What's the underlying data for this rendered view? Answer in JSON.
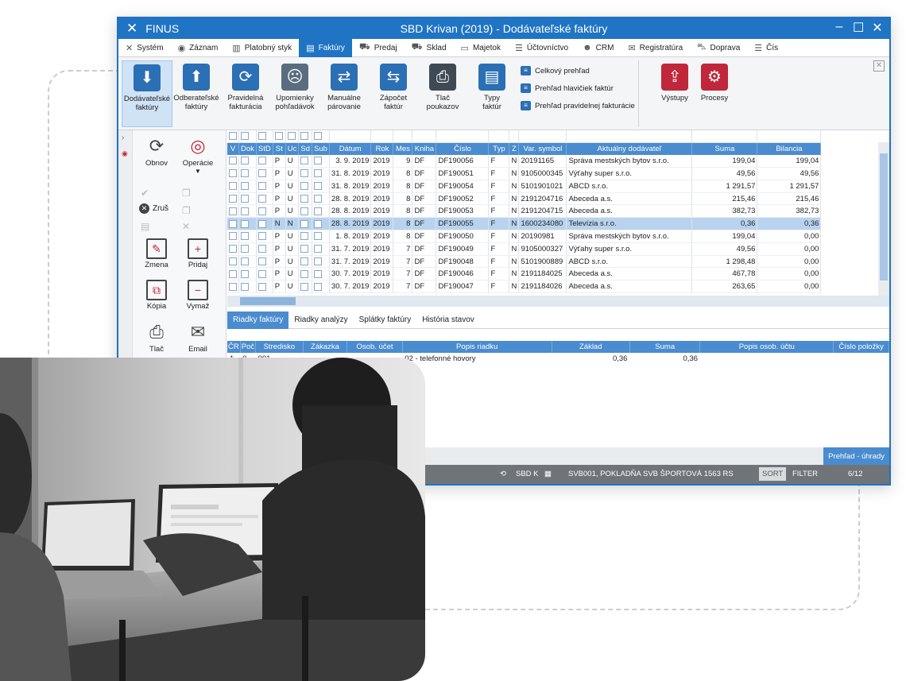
{
  "window": {
    "brand": "FINUS",
    "title": "SBD Krivan (2019) - Dodávateľské faktúry"
  },
  "menu": [
    {
      "label": "Systém",
      "icon": "x-icon"
    },
    {
      "label": "Záznam",
      "icon": "record-icon"
    },
    {
      "label": "Platobný styk",
      "icon": "bank-icon"
    },
    {
      "label": "Faktúry",
      "icon": "invoice-icon",
      "active": true
    },
    {
      "label": "Predaj",
      "icon": "cart-icon"
    },
    {
      "label": "Sklad",
      "icon": "truck-icon"
    },
    {
      "label": "Majetok",
      "icon": "monitor-icon"
    },
    {
      "label": "Účtovníctvo",
      "icon": "ledger-icon"
    },
    {
      "label": "CRM",
      "icon": "people-icon"
    },
    {
      "label": "Registratúra",
      "icon": "mail-icon"
    },
    {
      "label": "Doprava",
      "icon": "car-icon"
    },
    {
      "label": "Čís",
      "icon": "list-icon"
    }
  ],
  "ribbon": {
    "buttons": [
      {
        "l1": "Dodávateľské",
        "l2": "faktúry",
        "color": "#2b6fb5",
        "icon": "inbox-down-icon"
      },
      {
        "l1": "Odberateľské",
        "l2": "faktúry",
        "color": "#2b6fb5",
        "icon": "inbox-up-icon"
      },
      {
        "l1": "Pravidelná",
        "l2": "fakturácia",
        "color": "#2b6fb5",
        "icon": "recurring-invoice-icon"
      },
      {
        "l1": "Upomienky",
        "l2": "pohľadávok",
        "color": "#5a6c80",
        "icon": "reminder-icon"
      },
      {
        "l1": "Manuálne",
        "l2": "párovanie",
        "color": "#2b6fb5",
        "icon": "pairing-icon"
      },
      {
        "l1": "Zápočet",
        "l2": "faktúr",
        "color": "#2b6fb5",
        "icon": "offset-icon"
      },
      {
        "l1": "Tlač",
        "l2": "poukazov",
        "color": "#3f4a55",
        "icon": "printer-icon"
      },
      {
        "l1": "Typy",
        "l2": "faktúr",
        "color": "#2b6fb5",
        "icon": "invoice-types-icon"
      }
    ],
    "list": [
      "Celkový prehľad",
      "Prehľad hlavičiek faktúr",
      "Prehľad pravidelnej fakturácie"
    ],
    "outputs": {
      "label": "Výstupy",
      "color": "#c0273a"
    },
    "processes": {
      "label": "Procesy",
      "color": "#c0273a"
    }
  },
  "side": {
    "refresh": "Obnov",
    "operations": "Operácie",
    "cancel": "Zruš",
    "edit": "Zmena",
    "add": "Pridaj",
    "copy": "Kópia",
    "remove": "Vymaž",
    "print": "Tlač",
    "email": "Email"
  },
  "table": {
    "columns": [
      "V",
      "Dok",
      "StD",
      "St",
      "Uc",
      "Sd",
      "Sub",
      "Dátum",
      "Rok",
      "Mes",
      "Kniha",
      "Číslo",
      "Typ",
      "Z",
      "Var. symbol",
      "Aktuálny dodávateľ",
      "Suma",
      "Bilancia"
    ],
    "rows": [
      {
        "st": "P",
        "uc": "U",
        "date": "3. 9. 2019",
        "year": "2019",
        "month": "9",
        "book": "DF",
        "num": "DF190056",
        "type": "F",
        "z": "N",
        "vs": "20191165",
        "supplier": "Správa mestských bytov s.r.o.",
        "sum": "199,04",
        "bal": "199,04"
      },
      {
        "st": "P",
        "uc": "U",
        "date": "31. 8. 2019",
        "year": "2019",
        "month": "8",
        "book": "DF",
        "num": "DF190051",
        "type": "F",
        "z": "N",
        "vs": "9105000345",
        "supplier": "Výťahy super s.r.o.",
        "sum": "49,56",
        "bal": "49,56"
      },
      {
        "st": "P",
        "uc": "U",
        "date": "31. 8. 2019",
        "year": "2019",
        "month": "8",
        "book": "DF",
        "num": "DF190054",
        "type": "F",
        "z": "N",
        "vs": "5101901021",
        "supplier": "ABCD s.r.o.",
        "sum": "1 291,57",
        "bal": "1 291,57"
      },
      {
        "st": "P",
        "uc": "U",
        "date": "28. 8. 2019",
        "year": "2019",
        "month": "8",
        "book": "DF",
        "num": "DF190052",
        "type": "F",
        "z": "N",
        "vs": "2191204716",
        "supplier": "Abeceda a.s.",
        "sum": "215,46",
        "bal": "215,46"
      },
      {
        "st": "P",
        "uc": "U",
        "date": "28. 8. 2019",
        "year": "2019",
        "month": "8",
        "book": "DF",
        "num": "DF190053",
        "type": "F",
        "z": "N",
        "vs": "2191204715",
        "supplier": "Abeceda a.s.",
        "sum": "382,73",
        "bal": "382,73"
      },
      {
        "st": "N",
        "uc": "N",
        "date": "28. 8. 2019",
        "year": "2019",
        "month": "8",
        "book": "DF",
        "num": "DF190055",
        "type": "F",
        "z": "N",
        "vs": "1600234080",
        "supplier": "Televízia s.r.o.",
        "sum": "0,36",
        "bal": "0,36",
        "selected": true
      },
      {
        "st": "P",
        "uc": "U",
        "date": "1. 8. 2019",
        "year": "2019",
        "month": "8",
        "book": "DF",
        "num": "DF190050",
        "type": "F",
        "z": "N",
        "vs": "20190981",
        "supplier": "Správa mestských bytov s.r.o.",
        "sum": "199,04",
        "bal": "0,00"
      },
      {
        "st": "P",
        "uc": "U",
        "date": "31. 7. 2019",
        "year": "2019",
        "month": "7",
        "book": "DF",
        "num": "DF190049",
        "type": "F",
        "z": "N",
        "vs": "9105000327",
        "supplier": "Výťahy super s.r.o.",
        "sum": "49,56",
        "bal": "0,00"
      },
      {
        "st": "P",
        "uc": "U",
        "date": "31. 7. 2019",
        "year": "2019",
        "month": "7",
        "book": "DF",
        "num": "DF190048",
        "type": "F",
        "z": "N",
        "vs": "5101900889",
        "supplier": "ABCD s.r.o.",
        "sum": "1 298,48",
        "bal": "0,00"
      },
      {
        "st": "P",
        "uc": "U",
        "date": "30. 7. 2019",
        "year": "2019",
        "month": "7",
        "book": "DF",
        "num": "DF190046",
        "type": "F",
        "z": "N",
        "vs": "2191184025",
        "supplier": "Abeceda a.s.",
        "sum": "467,78",
        "bal": "0,00"
      },
      {
        "st": "P",
        "uc": "U",
        "date": "30. 7. 2019",
        "year": "2019",
        "month": "7",
        "book": "DF",
        "num": "DF190047",
        "type": "F",
        "z": "N",
        "vs": "2191184026",
        "supplier": "Abeceda a.s.",
        "sum": "263,65",
        "bal": "0,00"
      }
    ]
  },
  "tabs": [
    "Riadky faktúry",
    "Riadky analýzy",
    "Splátky faktúry",
    "História stavov"
  ],
  "detail": {
    "columns": [
      "ČR",
      "Poč",
      "Stredisko",
      "Zákazka",
      "Osob. účet",
      "Popis riadku",
      "Základ",
      "Suma",
      "Popis osob. účtu",
      "Číslo položky"
    ],
    "rows": [
      {
        "cr": "1",
        "poc": "0",
        "stred": "001",
        "zak": "",
        "osob": "",
        "popis": "02 - telefonné hovory",
        "zaklad": "0,36",
        "suma": "0,36",
        "popos": "",
        "cislo": ""
      }
    ]
  },
  "action": {
    "overview": "Prehľad - úhrady"
  },
  "status": {
    "sbd": "SBD K",
    "account": "SVB001, POKLADŇA SVB ŠPORTOVÁ 1563 RS",
    "sort": "SORT",
    "filter": "FILTER",
    "page": "6/12"
  }
}
